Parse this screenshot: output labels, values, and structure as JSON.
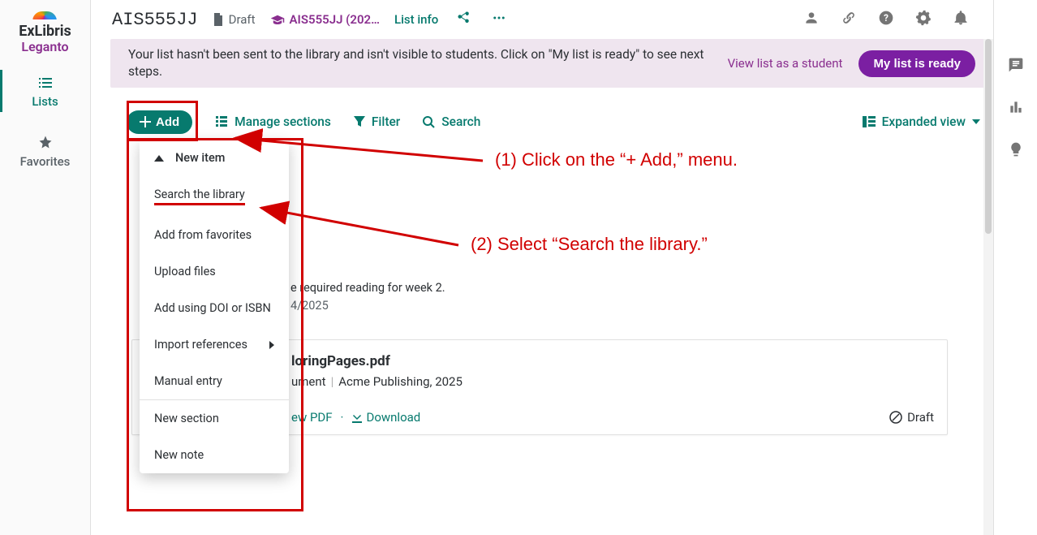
{
  "brand": {
    "line1": "ExLibris",
    "line2": "Leganto"
  },
  "nav": {
    "lists": "Lists",
    "favorites": "Favorites"
  },
  "header": {
    "course_code": "AIS555JJ",
    "status": "Draft",
    "course_pill": "AIS555JJ (202…",
    "list_info": "List info"
  },
  "banner": {
    "text": "Your list hasn't been sent to the library and isn't visible to students. Click on \"My list is ready\" to see next steps.",
    "view_link": "View list as a student",
    "ready_btn": "My list is ready"
  },
  "toolbar": {
    "add": "Add",
    "manage": "Manage sections",
    "filter": "Filter",
    "search": "Search",
    "view_mode": "Expanded view"
  },
  "add_menu": {
    "new_item": "New item",
    "search_library": "Search the library",
    "add_favorites": "Add from favorites",
    "upload_files": "Upload files",
    "add_doi_isbn": "Add using DOI or ISBN",
    "import_refs": "Import references",
    "manual_entry": "Manual entry",
    "new_section": "New section",
    "new_note": "New note"
  },
  "callouts": {
    "step1": "(1) Click on the “+ Add,” menu.",
    "step2": "(2) Select “Search the library.”"
  },
  "section": {
    "desc_tail": "e required reading for week 2.",
    "date_tail": "4/2025"
  },
  "item": {
    "title_tail": "loringPages.pdf",
    "meta_type_tail": "ument",
    "meta_pub": "Acme Publishing, 2025",
    "view_pdf_tail": "ew PDF",
    "download": "Download",
    "status": "Draft"
  }
}
